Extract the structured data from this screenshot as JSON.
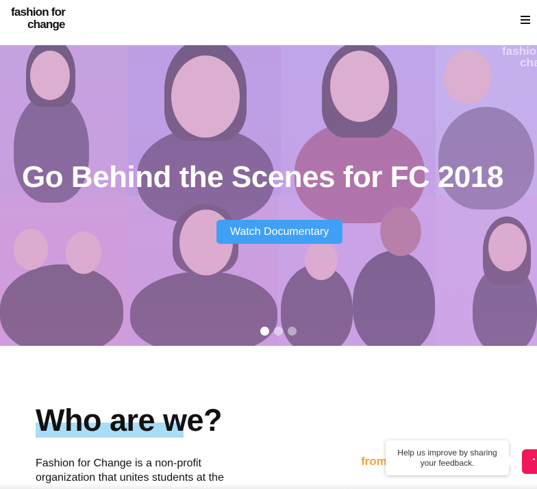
{
  "header": {
    "logo_line1": "fashion for",
    "logo_line2": "change",
    "menu_icon": "hamburger-menu-icon"
  },
  "hero": {
    "title": "Go Behind the Scenes for FC 2018",
    "cta_label": "Watch Documentary",
    "watermark_line1": "fashion",
    "watermark_line2": "cha",
    "slides_total": 3,
    "slide_active": 1,
    "overlay_color": "#c9a0e6",
    "cta_color": "#3fa0f5"
  },
  "about": {
    "title": "Who are we?",
    "highlight_color": "#a9dcf7",
    "text_line1": "Fashion for Change is a non-profit",
    "text_line2": "organization that unites students at the",
    "side_text": "from"
  },
  "feedback": {
    "message_line1": "Help us improve by sharing",
    "message_line2": "your feedback.",
    "tab_color": "#f0185a",
    "tab_icon": "smiley-face-icon"
  }
}
